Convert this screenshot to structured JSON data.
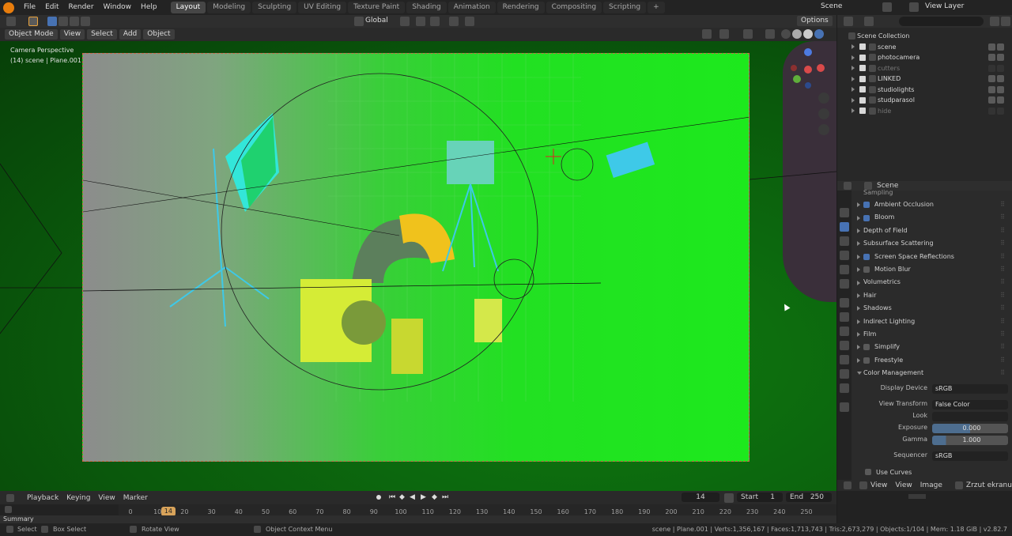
{
  "topbar": {
    "menus": [
      "File",
      "Edit",
      "Render",
      "Window",
      "Help"
    ],
    "workspaces": [
      "Layout",
      "Modeling",
      "Sculpting",
      "UV Editing",
      "Texture Paint",
      "Shading",
      "Animation",
      "Rendering",
      "Compositing",
      "Scripting"
    ],
    "active_workspace": "Layout",
    "plus": "+",
    "scene_label": "Scene",
    "view_layer_label": "View Layer"
  },
  "viewport_header": {
    "transform_orientation": "Global",
    "options_label": "Options",
    "mode": "Object Mode",
    "menus": [
      "View",
      "Select",
      "Add",
      "Object"
    ]
  },
  "viewport": {
    "overlay_title": "Camera Perspective",
    "overlay_subtitle": "(14) scene | Plane.001"
  },
  "outliner": {
    "root": "Scene Collection",
    "items": [
      {
        "label": "scene",
        "dim": false
      },
      {
        "label": "photocamera",
        "dim": false
      },
      {
        "label": "cutters",
        "dim": true
      },
      {
        "label": "LINKED",
        "dim": false
      },
      {
        "label": "studiolights",
        "dim": false
      },
      {
        "label": "studparasol",
        "dim": false
      },
      {
        "label": "hide",
        "dim": true
      }
    ]
  },
  "properties": {
    "context": "Scene",
    "cut_top_label": "Sampling",
    "panels": [
      {
        "label": "Ambient Occlusion",
        "check": true
      },
      {
        "label": "Bloom",
        "check": true
      },
      {
        "label": "Depth of Field",
        "check": null
      },
      {
        "label": "Subsurface Scattering",
        "check": null
      },
      {
        "label": "Screen Space Reflections",
        "check": true
      },
      {
        "label": "Motion Blur",
        "check": false
      },
      {
        "label": "Volumetrics",
        "check": null
      },
      {
        "label": "Hair",
        "check": null
      },
      {
        "label": "Shadows",
        "check": null
      },
      {
        "label": "Indirect Lighting",
        "check": null
      },
      {
        "label": "Film",
        "check": null
      },
      {
        "label": "Simplify",
        "check": false
      },
      {
        "label": "Freestyle",
        "check": false
      },
      {
        "label": "Color Management",
        "check": null
      }
    ],
    "color_management": {
      "display_device_label": "Display Device",
      "display_device": "sRGB",
      "view_transform_label": "View Transform",
      "view_transform": "False Color",
      "look_label": "Look",
      "look": "",
      "exposure_label": "Exposure",
      "exposure": "0.000",
      "gamma_label": "Gamma",
      "gamma": "1.000",
      "sequencer_label": "Sequencer",
      "sequencer": "sRGB",
      "use_curves": "Use Curves"
    }
  },
  "image_editor": {
    "menus": [
      "View",
      "View",
      "Image"
    ],
    "right_label": "Zrzut ekranu"
  },
  "timeline": {
    "menus": [
      "Playback",
      "Keying",
      "View",
      "Marker"
    ],
    "current_frame": "14",
    "start_label": "Start",
    "start": "1",
    "end_label": "End",
    "end": "250",
    "ticks": [
      "0",
      "10",
      "20",
      "30",
      "40",
      "50",
      "60",
      "70",
      "80",
      "90",
      "100",
      "110",
      "120",
      "130",
      "140",
      "150",
      "160",
      "170",
      "180",
      "190",
      "200",
      "210",
      "220",
      "230",
      "240",
      "250"
    ],
    "summary": "Summary"
  },
  "statusbar": {
    "hints": [
      "Select",
      "Box Select",
      "Rotate View",
      "Object Context Menu"
    ],
    "stats": "scene | Plane.001 | Verts:1,356,167 | Faces:1,713,743 | Tris:2,673,279 | Objects:1/104 | Mem: 1.18 GiB | v2.82.7"
  },
  "colors": {
    "accent": "#4772b3",
    "frame_indicator": "#d8a35a",
    "viewport_green": "#1de91d"
  }
}
